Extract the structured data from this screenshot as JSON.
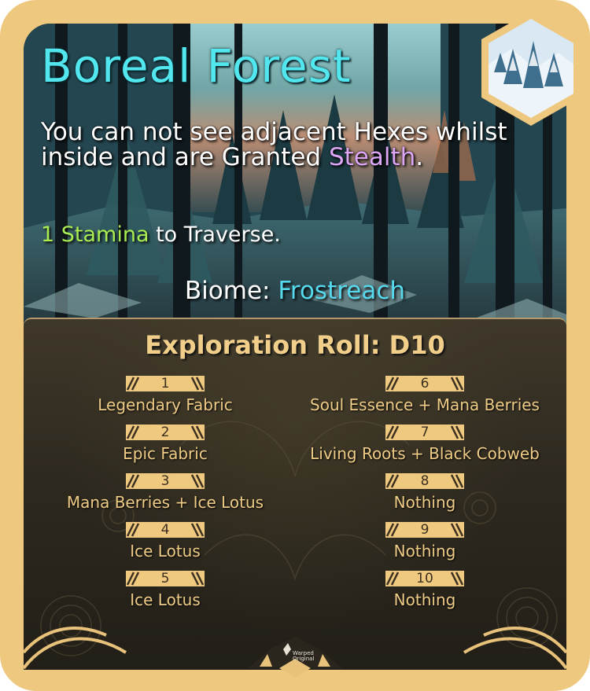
{
  "card": {
    "title": "Boreal Forest",
    "description": {
      "before": "You can not see adjacent Hexes whilst inside and are Granted ",
      "highlight": "Stealth",
      "after": "."
    },
    "cost": {
      "amount_label": "1 Stamina",
      "suffix": " to Traverse."
    },
    "biome": {
      "label": "Biome: ",
      "value": "Frostreach"
    },
    "colors": {
      "frame": "#efc880",
      "title": "#52e6ef",
      "stealth": "#dca6f5",
      "stamina": "#a8ec52",
      "biome": "#56d9ec",
      "panel_text": "#eecb86"
    },
    "thumbnail_icon": "snowy-forest-hex-icon"
  },
  "exploration": {
    "title": "Exploration Roll: D10",
    "left": [
      {
        "roll": "1",
        "reward": "Legendary Fabric"
      },
      {
        "roll": "2",
        "reward": "Epic Fabric"
      },
      {
        "roll": "3",
        "reward": "Mana Berries + Ice Lotus"
      },
      {
        "roll": "4",
        "reward": "Ice Lotus"
      },
      {
        "roll": "5",
        "reward": "Ice Lotus"
      }
    ],
    "right": [
      {
        "roll": "6",
        "reward": "Soul Essence + Mana Berries"
      },
      {
        "roll": "7",
        "reward": "Living Roots + Black Cobweb"
      },
      {
        "roll": "8",
        "reward": "Nothing"
      },
      {
        "roll": "9",
        "reward": "Nothing"
      },
      {
        "roll": "10",
        "reward": "Nothing"
      }
    ]
  },
  "footer": {
    "brand_line1": "Warped",
    "brand_line2": "Original"
  }
}
